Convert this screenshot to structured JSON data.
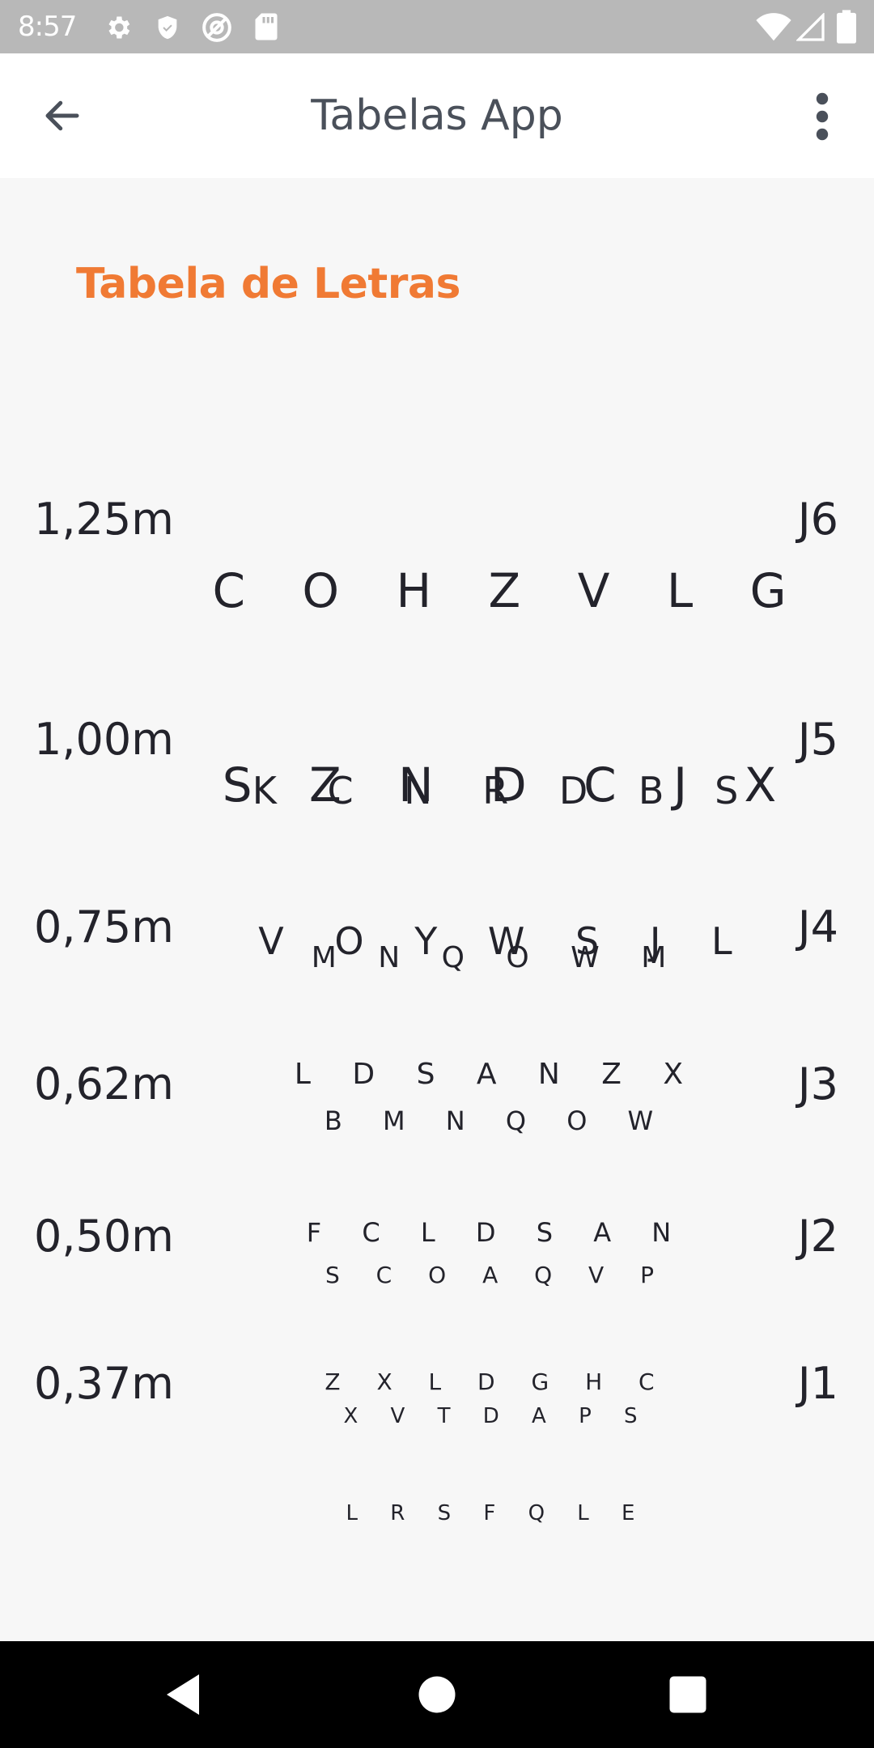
{
  "status_bar": {
    "time": "8:57",
    "icons": [
      "settings-gear-icon",
      "shield-icon",
      "at-sign-icon",
      "sd-card-icon",
      "wifi-icon",
      "signal-icon",
      "battery-icon"
    ]
  },
  "app_bar": {
    "title": "Tabelas App",
    "back_icon": "arrow-left-icon",
    "menu_icon": "more-vertical-icon"
  },
  "section_title": "Tabela de Letras",
  "rows": [
    {
      "distance": "1,25m",
      "line1": "C O H Z V L G",
      "line2": "S Z N D C J X",
      "jaeger": "J6"
    },
    {
      "distance": "1,00m",
      "line1": "K C N R D B S",
      "line2": "V O Y W S J L",
      "jaeger": "J5"
    },
    {
      "distance": "0,75m",
      "line1": "M N Q O W M",
      "line2": "L D S A N Z X",
      "jaeger": "J4"
    },
    {
      "distance": "0,62m",
      "line1": "B M N Q O W",
      "line2": "F C L D S A N",
      "jaeger": "J3"
    },
    {
      "distance": "0,50m",
      "line1": "S C O A Q V P",
      "line2": "Z X L D G H C",
      "jaeger": "J2"
    },
    {
      "distance": "0,37m",
      "line1": "X V T D A P S",
      "line2": "L R S F Q L E",
      "jaeger": "J1"
    }
  ],
  "nav_bar": {
    "icons": [
      "back-triangle-icon",
      "home-circle-icon",
      "recents-square-icon"
    ]
  },
  "colors": {
    "accent": "#f07a34",
    "status_bar": "#b8b8b8",
    "background": "#f7f7f7"
  }
}
